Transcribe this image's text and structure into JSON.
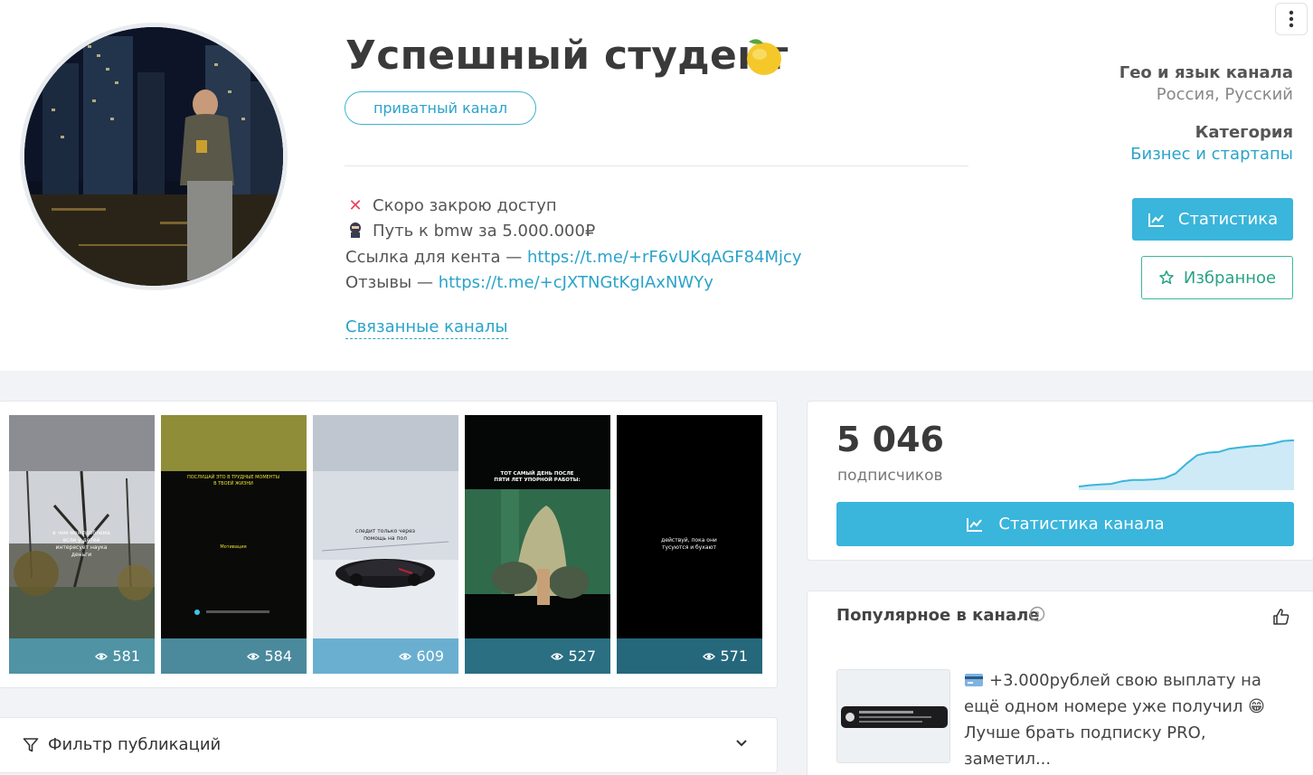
{
  "channel": {
    "title": "Успешный студент",
    "title_emoji": "lemon-emoji",
    "badge": "приватный канал",
    "description": [
      {
        "icon": "red-x-emoji",
        "text": "Скоро закрою доступ",
        "link": ""
      },
      {
        "icon": "ninja-emoji",
        "text": "Путь к bmw за 5.000.000₽",
        "link": ""
      },
      {
        "icon": "",
        "text": "Ссылка для кента — ",
        "link": "https://t.me/+rF6vUKqAGF84Mjcy"
      },
      {
        "icon": "",
        "text": "Отзывы — ",
        "link": "https://t.me/+cJXTNGtKgIAxNWYy"
      }
    ],
    "related_label": "Связанные каналы"
  },
  "sidebar": {
    "geo_label": "Гео и язык канала",
    "geo_value": "Россия, Русский",
    "category_label": "Категория",
    "category_value": "Бизнес и стартапы",
    "stats_button": "Статистика",
    "favorite_button": "Избранное"
  },
  "posts": [
    {
      "views": "581",
      "caption": "в чем моя проблема если у детей интересует наука деньги"
    },
    {
      "views": "584",
      "caption": "Мотивация"
    },
    {
      "views": "609",
      "caption": "следит только через помощь"
    },
    {
      "views": "527",
      "caption": "ТОТ САМЫЙ ДЕНЬ ПОСЛЕ ПЯТИ ЛЕТ УПОРНОЙ РАБОТЫ"
    },
    {
      "views": "571",
      "caption": "действуй, пока они тусуются и бухают"
    }
  ],
  "filter": {
    "label": "Фильтр публикаций"
  },
  "subscribers": {
    "count": "5 046",
    "label": "подписчиков",
    "button": "Статистика канала",
    "trend": [
      100,
      98,
      97,
      96,
      92,
      90,
      90,
      89,
      87,
      80,
      65,
      52,
      48,
      47,
      42,
      40,
      38,
      37,
      34,
      30,
      29
    ]
  },
  "popular": {
    "title": "Популярное в канале",
    "post_text": "+3.000рублей свою выплату на ещё одном номере уже получил 😁 Лучше брать подписку PRO, заметил...",
    "post_icon": "card-emoji"
  },
  "colors": {
    "accent": "#3ab5db",
    "link": "#2aa3c9",
    "favorite": "#3cb89a",
    "views_bar": "#4a9fb8"
  }
}
